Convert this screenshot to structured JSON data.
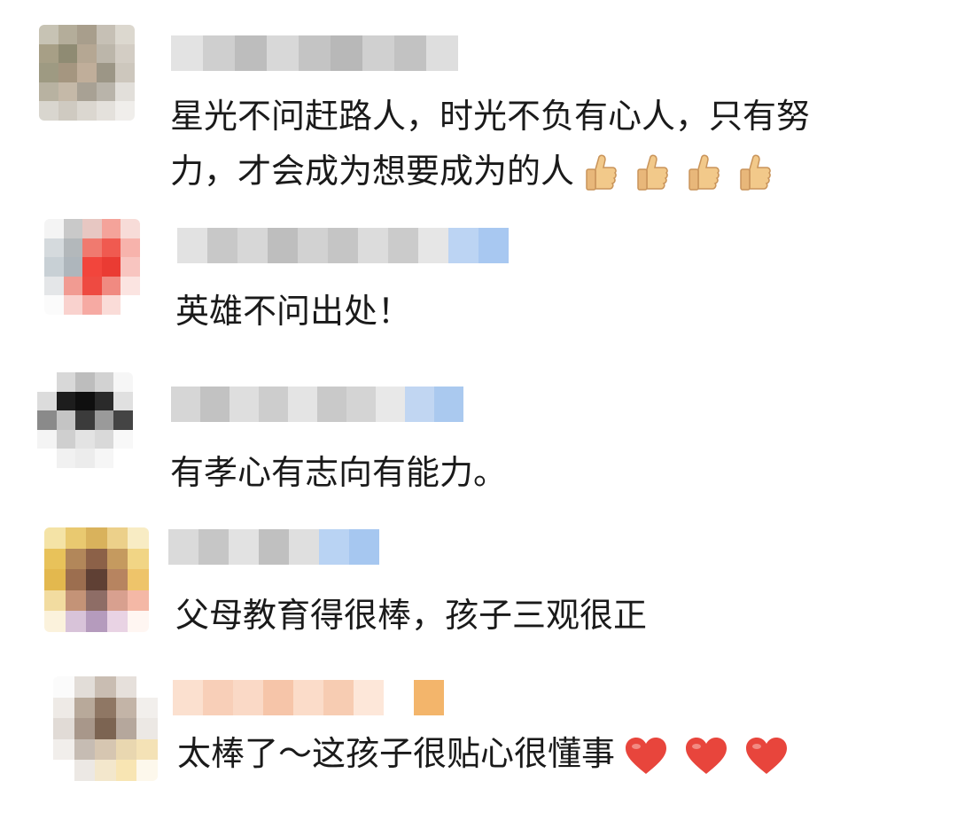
{
  "comments": [
    {
      "text_lines": [
        "星光不问赶路人，时光不负有心人，只有努",
        "力，才会成为想要成为的人"
      ],
      "trailing_emoji": "thumbs-up",
      "emoji_count": 4
    },
    {
      "text_lines": [
        "英雄不问出处！"
      ],
      "trailing_emoji": "",
      "emoji_count": 0
    },
    {
      "text_lines": [
        "有孝心有志向有能力。"
      ],
      "trailing_emoji": "",
      "emoji_count": 0
    },
    {
      "text_lines": [
        "父母教育得很棒，孩子三观很正"
      ],
      "trailing_emoji": "",
      "emoji_count": 0
    },
    {
      "text_lines": [
        "太棒了～这孩子很贴心很懂事"
      ],
      "trailing_emoji": "heart",
      "emoji_count": 3
    }
  ],
  "colors": {
    "text": "#1a1a1a",
    "thumb": "#f2c98a",
    "heart": "#e8453c"
  }
}
